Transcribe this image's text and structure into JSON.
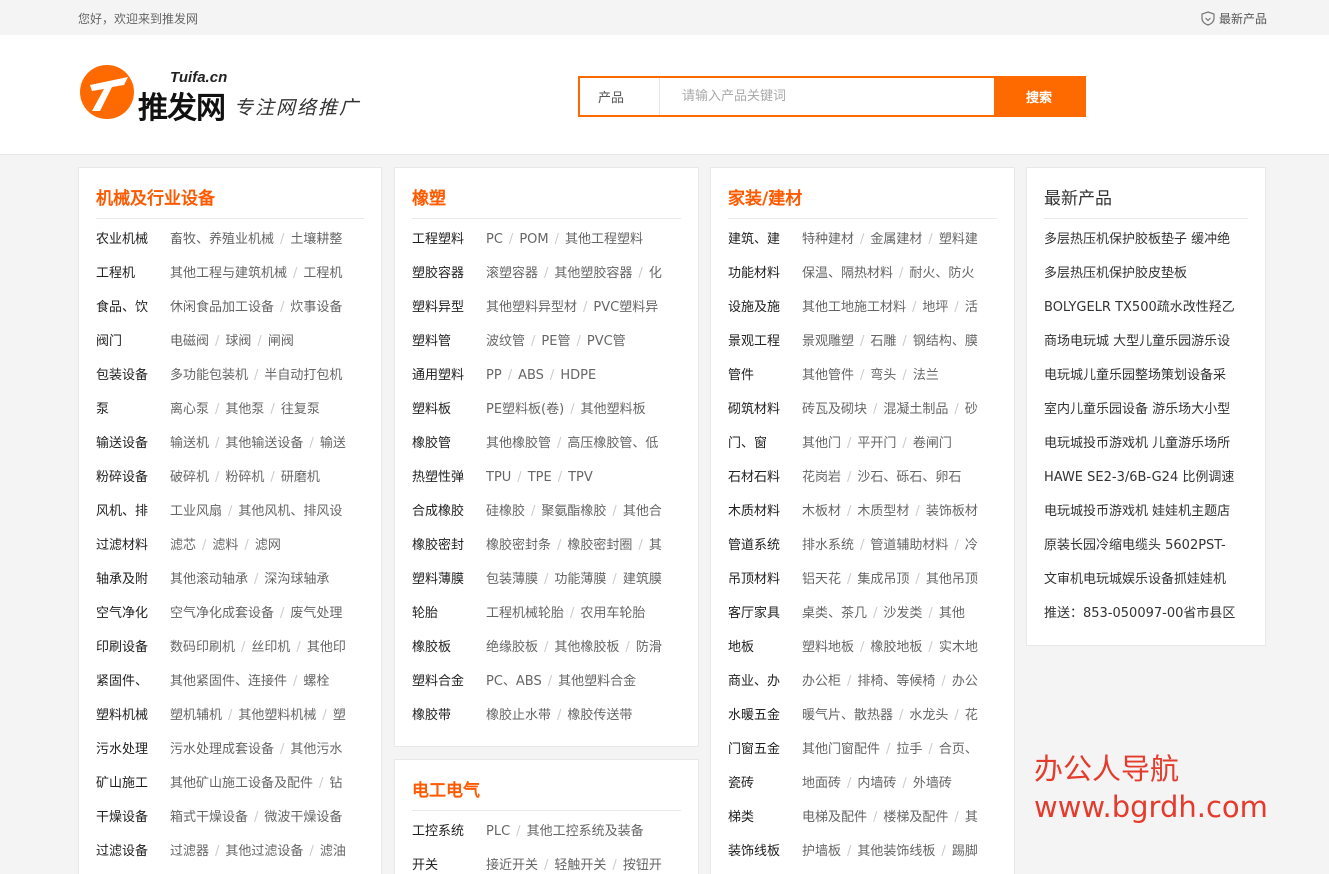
{
  "topbar": {
    "welcome": "您好，欢迎来到推发网",
    "latest_link": "最新产品"
  },
  "header": {
    "logo_small": "Tuifa.cn",
    "logo_brand": "推发网",
    "slogan": "专注网络推广"
  },
  "search": {
    "category": "产品",
    "placeholder": "请输入产品关键词",
    "button": "搜索"
  },
  "col1": {
    "title": "机械及行业设备",
    "rows": [
      {
        "cat": "农业机械",
        "subs": [
          "畜牧、养殖业机械",
          "土壤耕整"
        ]
      },
      {
        "cat": "工程机",
        "subs": [
          "其他工程与建筑机械",
          "工程机"
        ]
      },
      {
        "cat": "食品、饮",
        "subs": [
          "休闲食品加工设备",
          "炊事设备"
        ]
      },
      {
        "cat": "阀门",
        "subs": [
          "电磁阀",
          "球阀",
          "闸阀"
        ]
      },
      {
        "cat": "包装设备",
        "subs": [
          "多功能包装机",
          "半自动打包机"
        ]
      },
      {
        "cat": "泵",
        "subs": [
          "离心泵",
          "其他泵",
          "往复泵"
        ]
      },
      {
        "cat": "输送设备",
        "subs": [
          "输送机",
          "其他输送设备",
          "输送"
        ]
      },
      {
        "cat": "粉碎设备",
        "subs": [
          "破碎机",
          "粉碎机",
          "研磨机"
        ]
      },
      {
        "cat": "风机、排",
        "subs": [
          "工业风扇",
          "其他风机、排风设"
        ]
      },
      {
        "cat": "过滤材料",
        "subs": [
          "滤芯",
          "滤料",
          "滤网"
        ]
      },
      {
        "cat": "轴承及附",
        "subs": [
          "其他滚动轴承",
          "深沟球轴承"
        ]
      },
      {
        "cat": "空气净化",
        "subs": [
          "空气净化成套设备",
          "废气处理"
        ]
      },
      {
        "cat": "印刷设备",
        "subs": [
          "数码印刷机",
          "丝印机",
          "其他印"
        ]
      },
      {
        "cat": "紧固件、",
        "subs": [
          "其他紧固件、连接件",
          "螺栓"
        ]
      },
      {
        "cat": "塑料机械",
        "subs": [
          "塑机辅机",
          "其他塑料机械",
          "塑"
        ]
      },
      {
        "cat": "污水处理",
        "subs": [
          "污水处理成套设备",
          "其他污水"
        ]
      },
      {
        "cat": "矿山施工",
        "subs": [
          "其他矿山施工设备及配件",
          "钻"
        ]
      },
      {
        "cat": "干燥设备",
        "subs": [
          "箱式干燥设备",
          "微波干燥设备"
        ]
      },
      {
        "cat": "过滤设备",
        "subs": [
          "过滤器",
          "其他过滤设备",
          "滤油"
        ]
      }
    ]
  },
  "col2": {
    "title": "橡塑",
    "rows": [
      {
        "cat": "工程塑料",
        "subs": [
          "PC",
          "POM",
          "其他工程塑料"
        ]
      },
      {
        "cat": "塑胶容器",
        "subs": [
          "滚塑容器",
          "其他塑胶容器",
          "化"
        ]
      },
      {
        "cat": "塑料异型",
        "subs": [
          "其他塑料异型材",
          "PVC塑料异"
        ]
      },
      {
        "cat": "塑料管",
        "subs": [
          "波纹管",
          "PE管",
          "PVC管"
        ]
      },
      {
        "cat": "通用塑料",
        "subs": [
          "PP",
          "ABS",
          "HDPE"
        ]
      },
      {
        "cat": "塑料板",
        "subs": [
          "PE塑料板(卷)",
          "其他塑料板"
        ]
      },
      {
        "cat": "橡胶管",
        "subs": [
          "其他橡胶管",
          "高压橡胶管、低"
        ]
      },
      {
        "cat": "热塑性弹",
        "subs": [
          "TPU",
          "TPE",
          "TPV"
        ]
      },
      {
        "cat": "合成橡胶",
        "subs": [
          "硅橡胶",
          "聚氨酯橡胶",
          "其他合"
        ]
      },
      {
        "cat": "橡胶密封",
        "subs": [
          "橡胶密封条",
          "橡胶密封圈",
          "其"
        ]
      },
      {
        "cat": "塑料薄膜",
        "subs": [
          "包装薄膜",
          "功能薄膜",
          "建筑膜"
        ]
      },
      {
        "cat": "轮胎",
        "subs": [
          "工程机械轮胎",
          "农用车轮胎"
        ]
      },
      {
        "cat": "橡胶板",
        "subs": [
          "绝缘胶板",
          "其他橡胶板",
          "防滑"
        ]
      },
      {
        "cat": "塑料合金",
        "subs": [
          "PC、ABS",
          "其他塑料合金"
        ]
      },
      {
        "cat": "橡胶带",
        "subs": [
          "橡胶止水带",
          "橡胶传送带"
        ]
      }
    ]
  },
  "col2b": {
    "title": "电工电气",
    "rows": [
      {
        "cat": "工控系统",
        "subs": [
          "PLC",
          "其他工控系统及装备"
        ]
      },
      {
        "cat": "开关",
        "subs": [
          "接近开关",
          "轻触开关",
          "按钮开"
        ]
      }
    ]
  },
  "col3": {
    "title": "家装/建材",
    "rows": [
      {
        "cat": "建筑、建",
        "subs": [
          "特种建材",
          "金属建材",
          "塑料建"
        ]
      },
      {
        "cat": "功能材料",
        "subs": [
          "保温、隔热材料",
          "耐火、防火"
        ]
      },
      {
        "cat": "设施及施",
        "subs": [
          "其他工地施工材料",
          "地坪",
          "活"
        ]
      },
      {
        "cat": "景观工程",
        "subs": [
          "景观雕塑",
          "石雕",
          "钢结构、膜"
        ]
      },
      {
        "cat": "管件",
        "subs": [
          "其他管件",
          "弯头",
          "法兰"
        ]
      },
      {
        "cat": "砌筑材料",
        "subs": [
          "砖瓦及砌块",
          "混凝土制品",
          "砂"
        ]
      },
      {
        "cat": "门、窗",
        "subs": [
          "其他门",
          "平开门",
          "卷闸门"
        ]
      },
      {
        "cat": "石材石料",
        "subs": [
          "花岗岩",
          "沙石、砾石、卵石"
        ]
      },
      {
        "cat": "木质材料",
        "subs": [
          "木板材",
          "木质型材",
          "装饰板材"
        ]
      },
      {
        "cat": "管道系统",
        "subs": [
          "排水系统",
          "管道辅助材料",
          "冷"
        ]
      },
      {
        "cat": "吊顶材料",
        "subs": [
          "铝天花",
          "集成吊顶",
          "其他吊顶"
        ]
      },
      {
        "cat": "客厅家具",
        "subs": [
          "桌类、茶几",
          "沙发类",
          "其他"
        ]
      },
      {
        "cat": "地板",
        "subs": [
          "塑料地板",
          "橡胶地板",
          "实木地"
        ]
      },
      {
        "cat": "商业、办",
        "subs": [
          "办公柜",
          "排椅、等候椅",
          "办公"
        ]
      },
      {
        "cat": "水暖五金",
        "subs": [
          "暖气片、散热器",
          "水龙头",
          "花"
        ]
      },
      {
        "cat": "门窗五金",
        "subs": [
          "其他门窗配件",
          "拉手",
          "合页、"
        ]
      },
      {
        "cat": "瓷砖",
        "subs": [
          "地面砖",
          "内墙砖",
          "外墙砖"
        ]
      },
      {
        "cat": "梯类",
        "subs": [
          "电梯及配件",
          "楼梯及配件",
          "其"
        ]
      },
      {
        "cat": "装饰线板",
        "subs": [
          "护墙板",
          "其他装饰线板",
          "踢脚"
        ]
      }
    ]
  },
  "col4": {
    "title": "最新产品",
    "items": [
      "多层热压机保护胶板垫子 缓冲绝",
      "多层热压机保护胶皮垫板",
      "BOLYGELR TX500疏水改性羟乙",
      "商场电玩城 大型儿童乐园游乐设",
      "电玩城儿童乐园整场策划设备采",
      "室内儿童乐园设备 游乐场大小型",
      "电玩城投币游戏机 儿童游乐场所",
      "HAWE SE2-3/6B-G24 比例调速",
      "电玩城投币游戏机 娃娃机主题店",
      "原装长园冷缩电缆头 5602PST-",
      "文审机电玩城娱乐设备抓娃娃机",
      "推送：853-050097-00省市县区"
    ]
  },
  "watermark": {
    "line1": "办公人导航",
    "line2": "www.bgrdh.com"
  },
  "colors": {
    "accent": "#ff6a00",
    "title": "#ff5a00",
    "watermark": "#e53b2c"
  }
}
